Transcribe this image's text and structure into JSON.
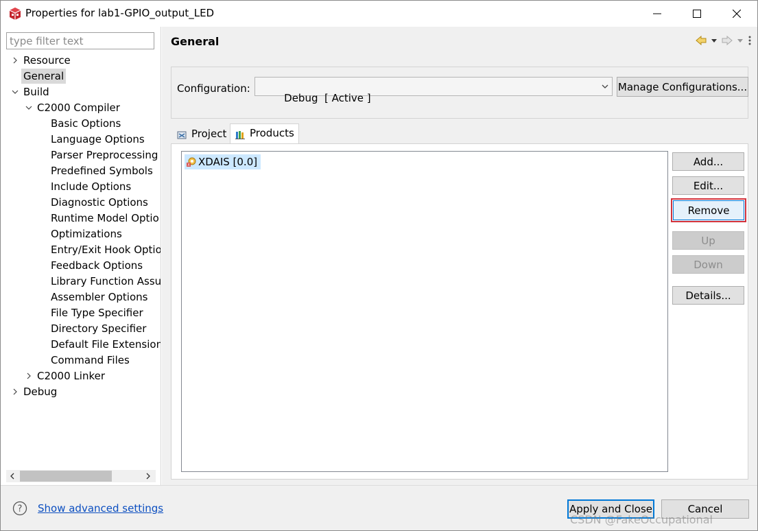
{
  "window": {
    "title": "Properties for lab1-GPIO_output_LED",
    "minimize_icon": "minimize-icon",
    "maximize_icon": "maximize-icon",
    "close_icon": "close-icon"
  },
  "sidebar": {
    "filter_placeholder": "type filter text",
    "tree": [
      {
        "label": "Resource",
        "level": 0,
        "expander": "collapsed"
      },
      {
        "label": "General",
        "level": 0,
        "expander": "none",
        "selected": true
      },
      {
        "label": "Build",
        "level": 0,
        "expander": "expanded"
      },
      {
        "label": "C2000 Compiler",
        "level": 1,
        "expander": "expanded"
      },
      {
        "label": "Basic Options",
        "level": 2,
        "expander": "none"
      },
      {
        "label": "Language Options",
        "level": 2,
        "expander": "none"
      },
      {
        "label": "Parser Preprocessing",
        "level": 2,
        "expander": "none"
      },
      {
        "label": "Predefined Symbols",
        "level": 2,
        "expander": "none"
      },
      {
        "label": "Include Options",
        "level": 2,
        "expander": "none"
      },
      {
        "label": "Diagnostic Options",
        "level": 2,
        "expander": "none"
      },
      {
        "label": "Runtime Model Optio",
        "level": 2,
        "expander": "none"
      },
      {
        "label": "Optimizations",
        "level": 2,
        "expander": "none"
      },
      {
        "label": "Entry/Exit Hook Optio",
        "level": 2,
        "expander": "none"
      },
      {
        "label": "Feedback Options",
        "level": 2,
        "expander": "none"
      },
      {
        "label": "Library Function Assu",
        "level": 2,
        "expander": "none"
      },
      {
        "label": "Assembler Options",
        "level": 2,
        "expander": "none"
      },
      {
        "label": "File Type Specifier",
        "level": 2,
        "expander": "none"
      },
      {
        "label": "Directory Specifier",
        "level": 2,
        "expander": "none"
      },
      {
        "label": "Default File Extension",
        "level": 2,
        "expander": "none"
      },
      {
        "label": "Command Files",
        "level": 2,
        "expander": "none"
      },
      {
        "label": "C2000 Linker",
        "level": 1,
        "expander": "collapsed"
      },
      {
        "label": "Debug",
        "level": 0,
        "expander": "collapsed"
      }
    ]
  },
  "main": {
    "title": "General",
    "configuration_label": "Configuration:",
    "configuration_value": "Debug  [ Active ]",
    "manage_button": "Manage Configurations...",
    "tabs": [
      {
        "label": "Project",
        "icon": "project-icon",
        "active": false
      },
      {
        "label": "Products",
        "icon": "products-icon",
        "active": true
      }
    ],
    "products": [
      {
        "label": "XDAIS  [0.0]",
        "selected": true
      }
    ],
    "buttons": {
      "add": "Add...",
      "edit": "Edit...",
      "remove": "Remove",
      "up": "Up",
      "down": "Down",
      "details": "Details..."
    },
    "highlight_color": "#d1323c"
  },
  "footer": {
    "advanced_link": "Show advanced settings",
    "apply_close": "Apply and Close",
    "cancel": "Cancel",
    "watermark": "CSDN @FakeOccupational"
  }
}
